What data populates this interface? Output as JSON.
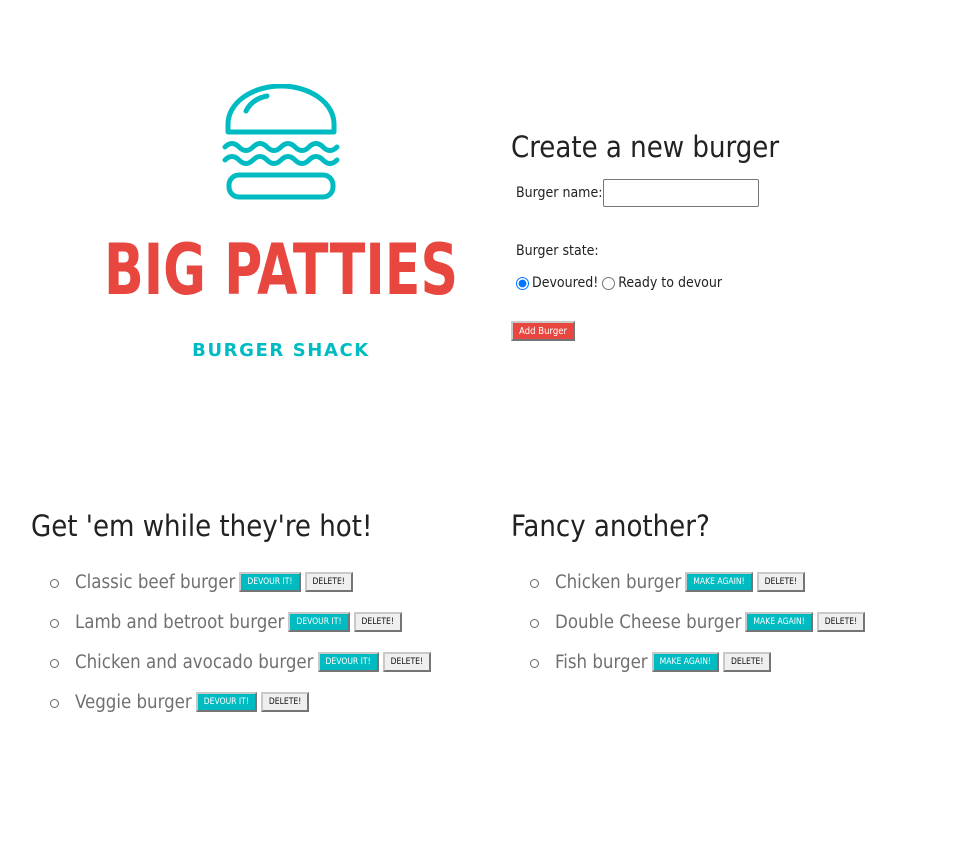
{
  "colors": {
    "teal": "#00bcc2",
    "red": "#e8473f",
    "delete_bg": "#efefef"
  },
  "brand": {
    "logo_icon": "burger-icon",
    "title": "BIG PATTIES",
    "subtitle": "BURGER SHACK"
  },
  "form": {
    "heading": "Create a new burger",
    "name_label": "Burger name:",
    "name_value": "",
    "state_label": "Burger state:",
    "options": [
      "Devoured!",
      "Ready to devour"
    ],
    "selected_option": "Devoured!",
    "submit_label": "Add Burger"
  },
  "hot": {
    "heading": "Get 'em while they're hot!",
    "action_label": "DEVOUR IT!",
    "delete_label": "DELETE!",
    "items": [
      {
        "name": "Classic beef burger"
      },
      {
        "name": "Lamb and betroot burger"
      },
      {
        "name": "Chicken and avocado burger"
      },
      {
        "name": "Veggie burger"
      }
    ]
  },
  "devoured": {
    "heading": "Fancy another?",
    "action_label": "MAKE AGAIN!",
    "delete_label": "DELETE!",
    "items": [
      {
        "name": "Chicken burger"
      },
      {
        "name": "Double Cheese burger"
      },
      {
        "name": "Fish burger"
      }
    ]
  }
}
